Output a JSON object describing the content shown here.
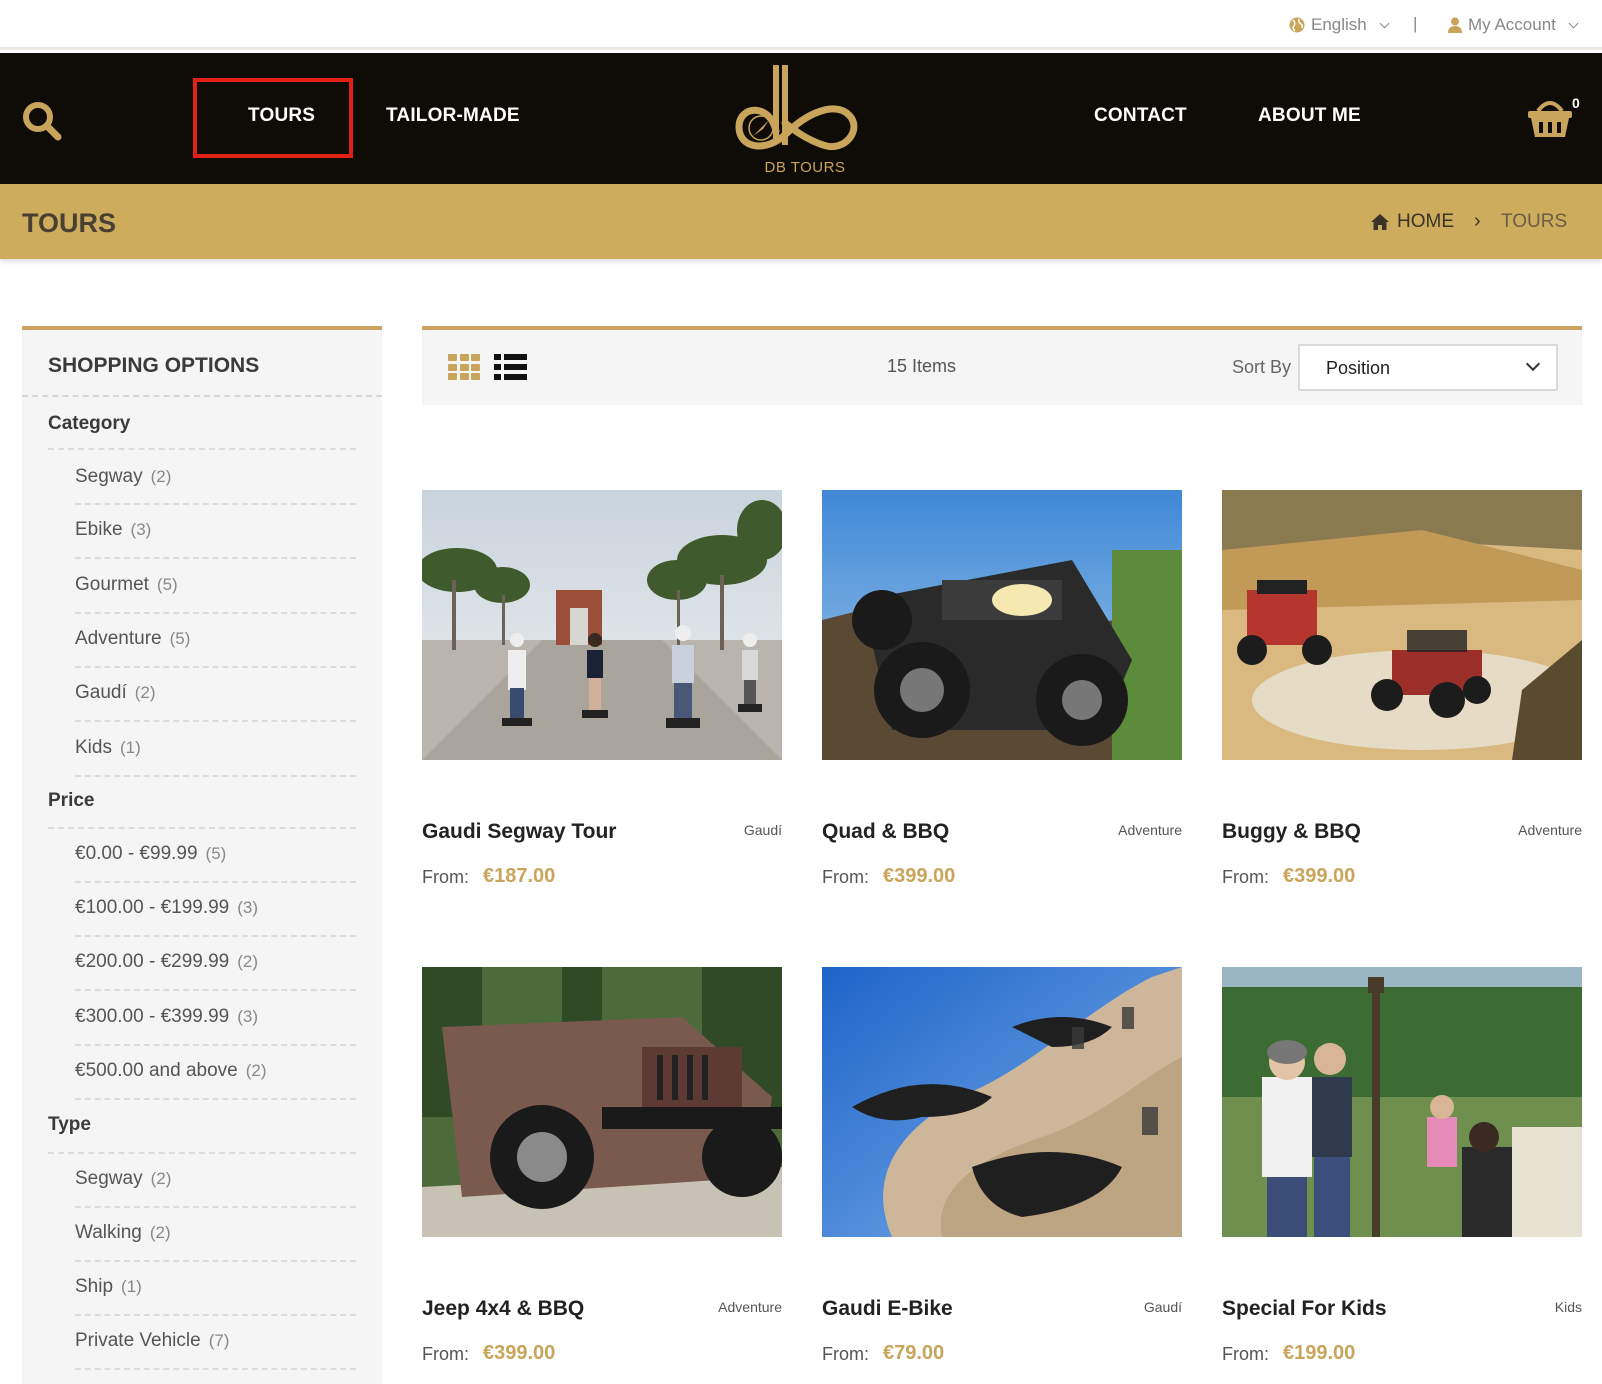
{
  "topbar": {
    "language": "English",
    "separator": "|",
    "account": "My Account"
  },
  "nav": {
    "tours": "TOURS",
    "tailor_made": "TAILOR-MADE",
    "contact": "CONTACT",
    "about": "ABOUT ME",
    "logo_text": "DB TOURS",
    "cart_count": "0"
  },
  "page": {
    "title": "TOURS",
    "breadcrumb_home": "HOME",
    "breadcrumb_sep": "›",
    "breadcrumb_current": "TOURS"
  },
  "sidebar": {
    "title": "SHOPPING OPTIONS",
    "category_head": "Category",
    "category": [
      {
        "label": "Segway",
        "count": "(2)"
      },
      {
        "label": "Ebike",
        "count": "(3)"
      },
      {
        "label": "Gourmet",
        "count": "(5)"
      },
      {
        "label": "Adventure",
        "count": "(5)"
      },
      {
        "label": "Gaudí",
        "count": "(2)"
      },
      {
        "label": "Kids",
        "count": "(1)"
      }
    ],
    "price_head": "Price",
    "price": [
      {
        "label": "€0.00 - €99.99",
        "count": "(5)"
      },
      {
        "label": "€100.00 - €199.99",
        "count": "(3)"
      },
      {
        "label": "€200.00 - €299.99",
        "count": "(2)"
      },
      {
        "label": "€300.00 - €399.99",
        "count": "(3)"
      },
      {
        "label": "€500.00 and above",
        "count": "(2)"
      }
    ],
    "type_head": "Type",
    "type": [
      {
        "label": "Segway",
        "count": "(2)"
      },
      {
        "label": "Walking",
        "count": "(2)"
      },
      {
        "label": "Ship",
        "count": "(1)"
      },
      {
        "label": "Private Vehicle",
        "count": "(7)"
      }
    ]
  },
  "toolbar": {
    "items_count": "15 Items",
    "sort_label": "Sort By",
    "sort_value": "Position"
  },
  "products": [
    {
      "name": "Gaudi Segway Tour",
      "category": "Gaudí",
      "from_label": "From:",
      "price": "€187.00"
    },
    {
      "name": "Quad & BBQ",
      "category": "Adventure",
      "from_label": "From:",
      "price": "€399.00"
    },
    {
      "name": "Buggy & BBQ",
      "category": "Adventure",
      "from_label": "From:",
      "price": "€399.00"
    },
    {
      "name": "Jeep 4x4 & BBQ",
      "category": "Adventure",
      "from_label": "From:",
      "price": "€399.00"
    },
    {
      "name": "Gaudi E-Bike",
      "category": "Gaudí",
      "from_label": "From:",
      "price": "€79.00"
    },
    {
      "name": "Special For Kids",
      "category": "Kids",
      "from_label": "From:",
      "price": "€199.00"
    }
  ],
  "colors": {
    "gold": "#c9a45b",
    "header_bg": "#0f0c08",
    "title_band": "#cdac5e",
    "highlight": "#e02216"
  }
}
